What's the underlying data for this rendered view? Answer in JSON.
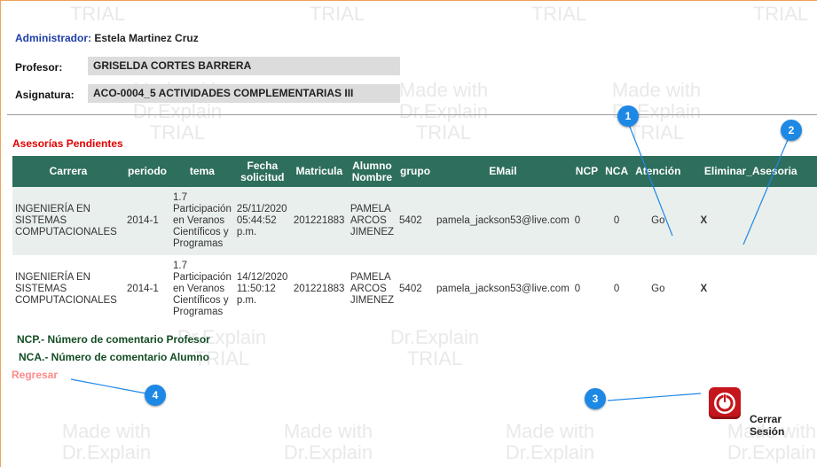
{
  "header": {
    "admin_key": "Administrador:",
    "admin_name": "Estela Martinez Cruz",
    "profesor_key": "Profesor:",
    "profesor_value": "GRISELDA CORTES BARRERA",
    "asignatura_key": "Asignatura:",
    "asignatura_value": "ACO-0004_5 ACTIVIDADES COMPLEMENTARIAS III"
  },
  "section_title": "Asesorías Pendientes",
  "table": {
    "headers": [
      "Carrera",
      "periodo",
      "tema",
      "Fecha solicitud",
      "Matricula",
      "Alumno Nombre",
      "grupo",
      "EMail",
      "NCP",
      "NCA",
      "Atención",
      "Eliminar_Asesoria"
    ],
    "rows": [
      {
        "carrera": "INGENIERÍA EN SISTEMAS COMPUTACIONALES",
        "periodo": "2014-1",
        "tema": "1.7 Participación en Veranos Científicos y Programas",
        "fecha": "25/11/2020 05:44:52 p.m.",
        "matricula": "201221883",
        "alumno": "PAMELA ARCOS JIMENEZ",
        "grupo": "5402",
        "email": "pamela_jackson53@live.com",
        "ncp": "0",
        "nca": "0",
        "atencion": "Go",
        "eliminar": "X"
      },
      {
        "carrera": "INGENIERÍA EN SISTEMAS COMPUTACIONALES",
        "periodo": "2014-1",
        "tema": "1.7 Participación en Veranos Científicos y Programas",
        "fecha": "14/12/2020 11:50:12 p.m.",
        "matricula": "201221883",
        "alumno": "PAMELA ARCOS JIMENEZ",
        "grupo": "5402",
        "email": "pamela_jackson53@live.com",
        "ncp": "0",
        "nca": "0",
        "atencion": "Go",
        "eliminar": "X"
      }
    ]
  },
  "legend": {
    "ncp": "NCP.- Número de comentario Profesor",
    "nca": "NCA.- Número de comentario Alumno"
  },
  "regresar": "Regresar",
  "logout_label": "Cerrar Sesión",
  "markers": [
    "1",
    "2",
    "3",
    "4"
  ],
  "watermarks": [
    "TRIAL",
    "TRIAL",
    "TRIAL",
    "TRIAL",
    "Made with Dr.Explain TRIAL",
    "Made with Dr.Explain TRIAL",
    "Made with Dr.Explain TRIAL",
    "Made with Dr.Explain TRIAL",
    "Made with Dr.Explain TRIAL",
    "Made with Dr.Explain TRIAL",
    "Made with Dr.Explain TRIAL",
    "Made with Dr.Explain TRIAL",
    "Made with Dr.Explain",
    "Made with Dr.Explain",
    "Made with Dr.Explain",
    "Made with Dr.Explain"
  ],
  "colors": {
    "header_bg": "#2e6e5c",
    "accent_red": "#e10000",
    "marker_blue": "#1e88e5",
    "link_pink": "#ff8a8a"
  }
}
